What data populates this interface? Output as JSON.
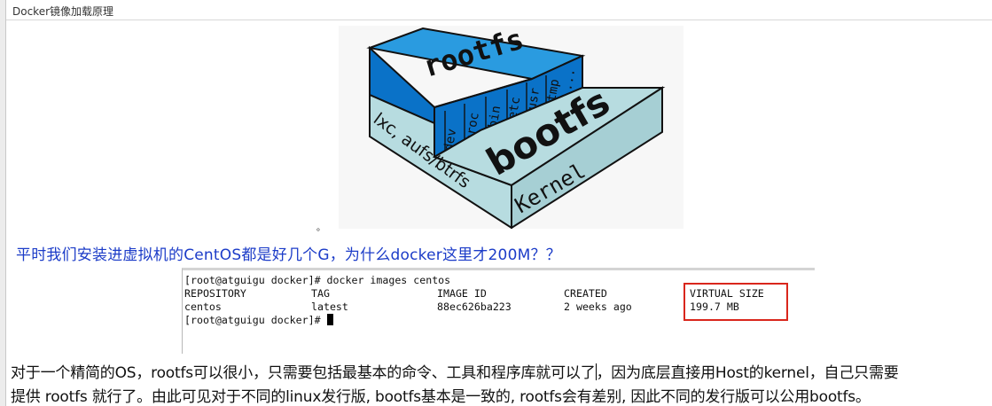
{
  "header": {
    "title": "Docker镜像加载原理"
  },
  "diagram": {
    "top_block_label": "rootfs",
    "top_block_dirs": [
      "dev",
      "proc",
      "bin",
      "etc",
      "usr",
      "tmp",
      "..."
    ],
    "side_label": "lxc, aufs/btrfs",
    "bottom_block_label": "bootfs",
    "kernel_label": "Kernel",
    "colors": {
      "rootfs_top": "#2a9be0",
      "rootfs_front": "#0a72c8",
      "bootfs_top": "#b7dce0",
      "bootfs_front": "#a6cfd4",
      "outline": "#111111"
    }
  },
  "dot": "。",
  "question": {
    "text": "平时我们安装进虚拟机的CentOS都是好几个G，为什么docker这里才200M？？"
  },
  "terminal": {
    "prompt_line": "[root@atguigu docker]# docker images centos",
    "headers": [
      "REPOSITORY",
      "TAG",
      "IMAGE ID",
      "CREATED",
      "VIRTUAL SIZE"
    ],
    "row": [
      "centos",
      "latest",
      "88ec626ba223",
      "2 weeks ago",
      "199.7 MB"
    ],
    "final_prompt": "[root@atguigu docker]# "
  },
  "body": {
    "line1_a": "对于一个精简的OS，rootfs可以很小，只需要包括最基本的命令、工具和程序库就可以了",
    "line1_b": "，因为底层直接用Host的kernel，自己只需要",
    "line2": "提供 rootfs 就行了。由此可见对于不同的linux发行版, bootfs基本是一致的, rootfs会有差别, 因此不同的发行版可以公用bootfs。"
  }
}
